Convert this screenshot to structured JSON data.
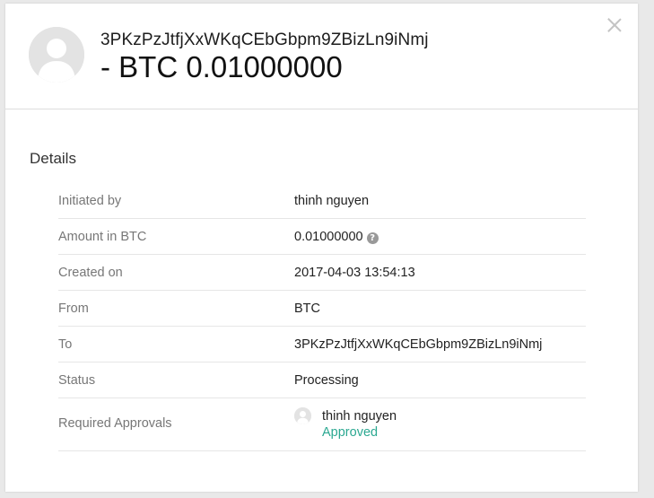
{
  "header": {
    "title": "3PKzPzJtfjXxWKqCEbGbpm9ZBizLn9iNmj",
    "amount": "- BTC 0.01000000"
  },
  "details": {
    "section_title": "Details",
    "rows": [
      {
        "label": "Initiated by",
        "value": "thinh nguyen"
      },
      {
        "label": "Amount in BTC",
        "value": "0.01000000"
      },
      {
        "label": "Created on",
        "value": "2017-04-03 13:54:13"
      },
      {
        "label": "From",
        "value": "BTC"
      },
      {
        "label": "To",
        "value": "3PKzPzJtfjXxWKqCEbGbpm9ZBizLn9iNmj"
      },
      {
        "label": "Status",
        "value": "Processing"
      }
    ],
    "approvals": {
      "label": "Required Approvals",
      "approver_name": "thinh nguyen",
      "approver_status": "Approved"
    },
    "help_icon_glyph": "?"
  },
  "icons": {
    "close": "close-icon",
    "avatar": "user-avatar-icon",
    "help": "question-icon"
  },
  "colors": {
    "approved": "#2ba891",
    "label": "#777777",
    "background": "#e9e9e9"
  }
}
